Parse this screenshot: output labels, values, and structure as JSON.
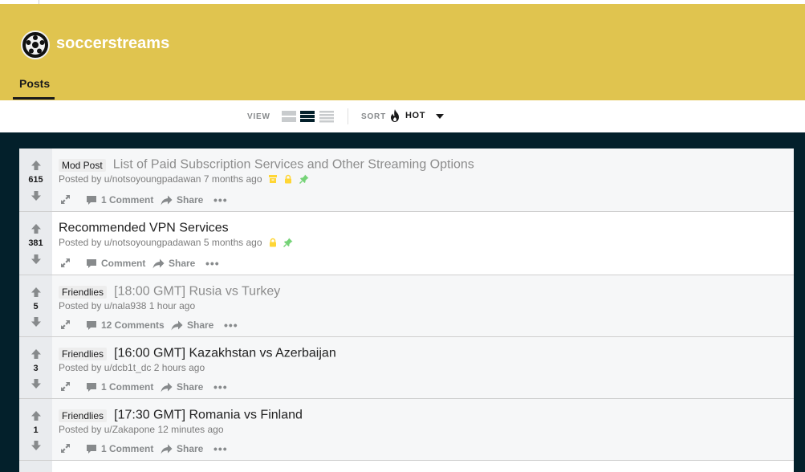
{
  "subreddit": {
    "name": "soccerstreams",
    "tab": "Posts",
    "logo": "soccer-ball-icon"
  },
  "toolbar": {
    "view_label": "VIEW",
    "sort_label": "SORT",
    "sort_value": "HOT"
  },
  "colors": {
    "banner": "#e0c44f",
    "background": "#03202b",
    "mod_yellow": "#ffd635",
    "pin_green": "#75d377"
  },
  "posts": [
    {
      "flair": "Mod Post",
      "title": "List of Paid Subscription Services and Other Streaming Options",
      "score": "615",
      "author": "Posted by u/notsoyoungpadawan",
      "time": "7 months ago",
      "comments": "1 Comment",
      "share": "Share"
    },
    {
      "flair": "",
      "title": "Recommended VPN Services",
      "score": "381",
      "author": "Posted by u/notsoyoungpadawan",
      "time": "5 months ago",
      "comments": "Comment",
      "share": "Share"
    },
    {
      "flair": "Friendlies",
      "title": "[18:00 GMT] Rusia vs Turkey",
      "score": "5",
      "author": "Posted by u/nala938",
      "time": "1 hour ago",
      "comments": "12 Comments",
      "share": "Share"
    },
    {
      "flair": "Friendlies",
      "title": "[16:00 GMT] Kazakhstan vs Azerbaijan",
      "score": "3",
      "author": "Posted by u/dcb1t_dc",
      "time": "2 hours ago",
      "comments": "1 Comment",
      "share": "Share"
    },
    {
      "flair": "Friendlies",
      "title": "[17:30 GMT] Romania vs Finland",
      "score": "1",
      "author": "Posted by u/Zakapone",
      "time": "12 minutes ago",
      "comments": "1 Comment",
      "share": "Share"
    }
  ]
}
